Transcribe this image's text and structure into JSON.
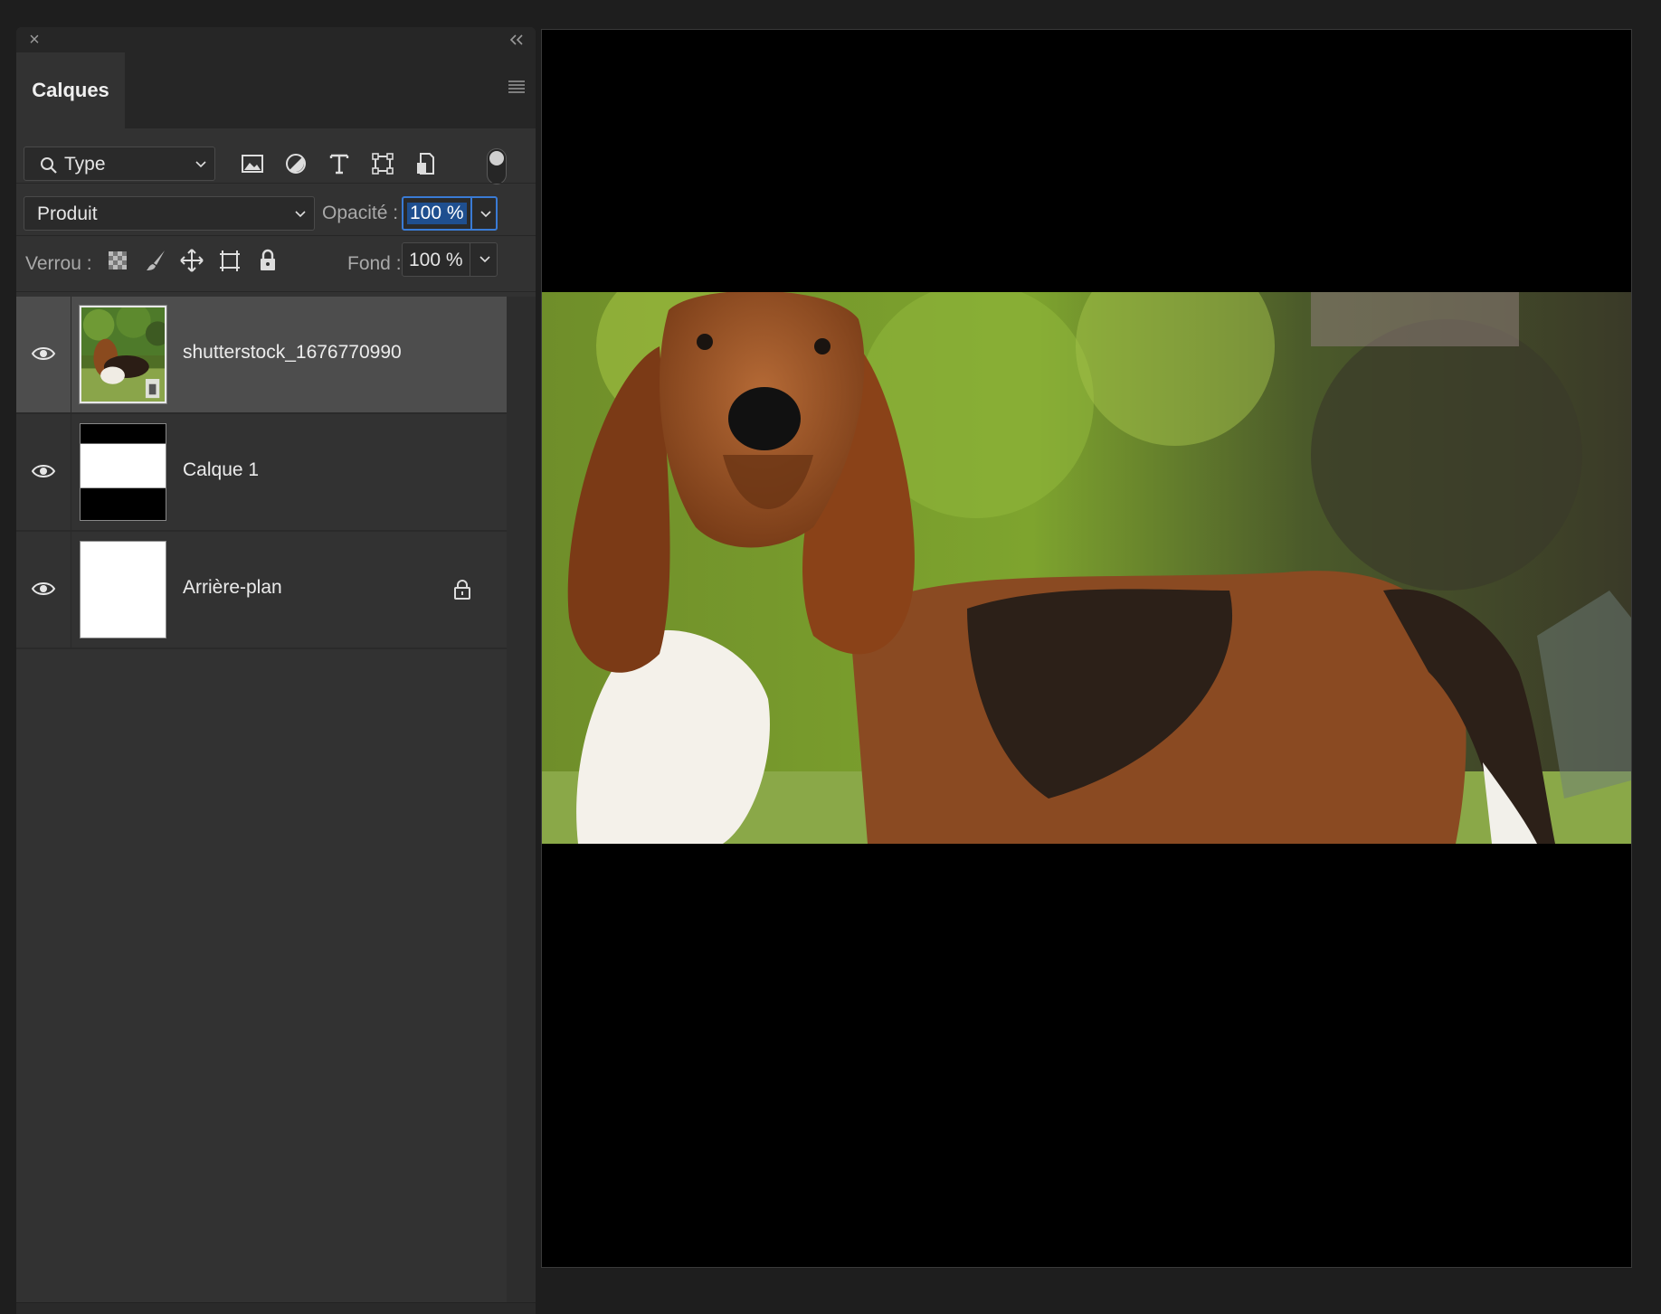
{
  "panel": {
    "title": "Calques",
    "filter": {
      "label": "Type"
    },
    "blend_mode": "Produit",
    "opacity": {
      "label": "Opacité :",
      "value": "100 %"
    },
    "lock": {
      "label": "Verrou :"
    },
    "fill": {
      "label": "Fond :",
      "value": "100 %"
    }
  },
  "layers": [
    {
      "name": "shutterstock_1676770990",
      "visible": true,
      "selected": true,
      "thumbnail": "photo-smart-object",
      "locked": false
    },
    {
      "name": "Calque 1",
      "visible": true,
      "selected": false,
      "thumbnail": "black-white-black-bands",
      "locked": false
    },
    {
      "name": "Arrière-plan",
      "visible": true,
      "selected": false,
      "thumbnail": "white",
      "locked": true
    }
  ],
  "icons": {
    "panel": [
      "close-icon",
      "collapse-icon",
      "panel-menu-icon"
    ],
    "filters": [
      "image-filter-icon",
      "adjustment-filter-icon",
      "type-filter-icon",
      "shape-filter-icon",
      "smart-object-filter-icon"
    ],
    "locks": [
      "lock-transparency-icon",
      "lock-pixels-icon",
      "lock-position-icon",
      "lock-artboard-icon",
      "lock-all-icon"
    ]
  },
  "colors": {
    "panel_bg": "#323232",
    "selected_row": "#4d4d4d",
    "accent": "#3a7bd5",
    "canvas_bg": "#000000"
  }
}
